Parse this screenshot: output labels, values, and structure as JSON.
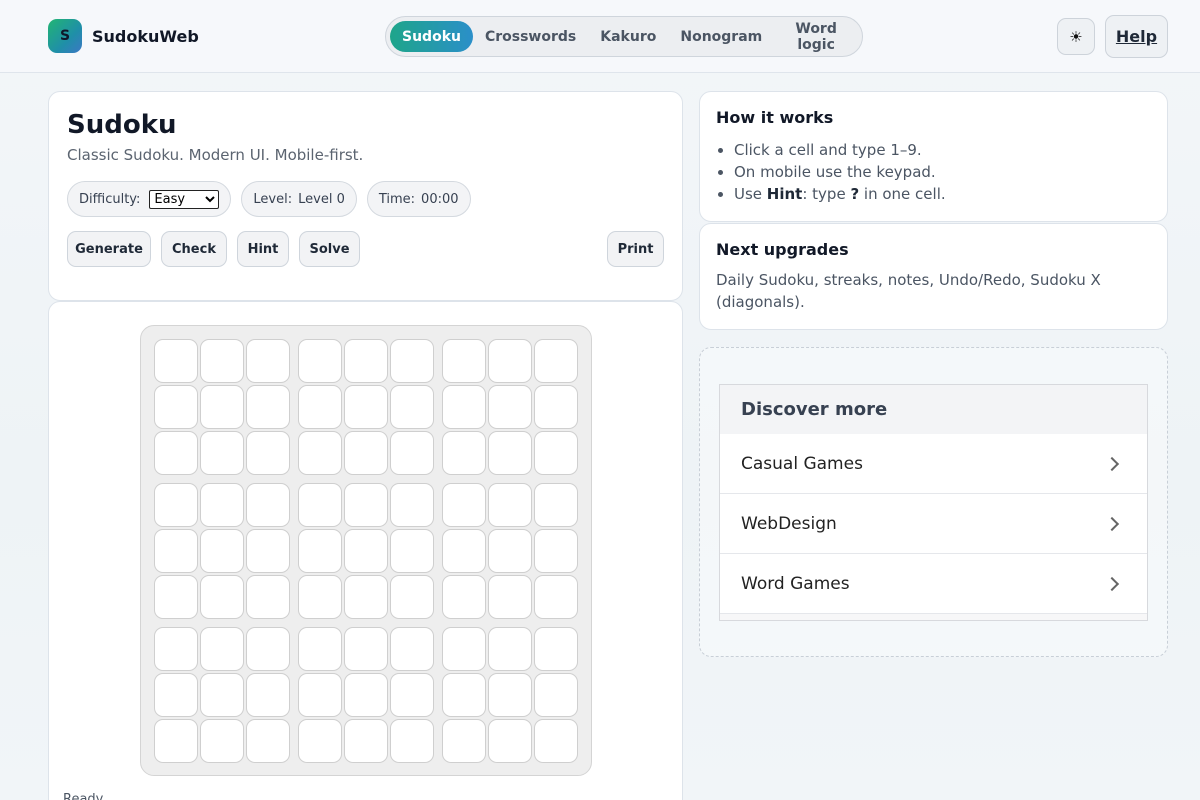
{
  "brand": {
    "logo_letter": "S",
    "name": "SudokuWeb"
  },
  "nav": {
    "tabs": [
      "Sudoku",
      "Crosswords",
      "Kakuro",
      "Nonogram",
      "Word logic"
    ],
    "active": "Sudoku"
  },
  "header": {
    "theme_icon": "☀",
    "help_label": "Help"
  },
  "main": {
    "title": "Sudoku",
    "subtitle": "Classic Sudoku. Modern UI. Mobile-first.",
    "difficulty_label": "Difficulty:",
    "difficulty_value": "Easy",
    "level_label": "Level:",
    "level_value": "Level 0",
    "time_label": "Time:",
    "time_value": "00:00",
    "buttons": {
      "generate": "Generate",
      "check": "Check",
      "hint": "Hint",
      "solve": "Solve",
      "print": "Print"
    }
  },
  "board": {
    "rows": 9,
    "cols": 9,
    "footer": "Ready."
  },
  "how_it_works": {
    "title": "How it works",
    "item1": "Click a cell and type 1–9.",
    "item2": "On mobile use the keypad.",
    "item3_prefix": "Use ",
    "item3_bold1": "Hint",
    "item3_mid": ": type ",
    "item3_bold2": "?",
    "item3_suffix": " in one cell."
  },
  "upgrades": {
    "title": "Next upgrades",
    "text": "Daily Sudoku, streaks, notes, Undo/Redo, Sudoku X (diagonals)."
  },
  "discover": {
    "title": "Discover more",
    "items": [
      "Casual Games",
      "WebDesign",
      "Word Games"
    ]
  },
  "colors": {
    "accent_start": "#1ea58a",
    "accent_end": "#2b8fc9"
  }
}
